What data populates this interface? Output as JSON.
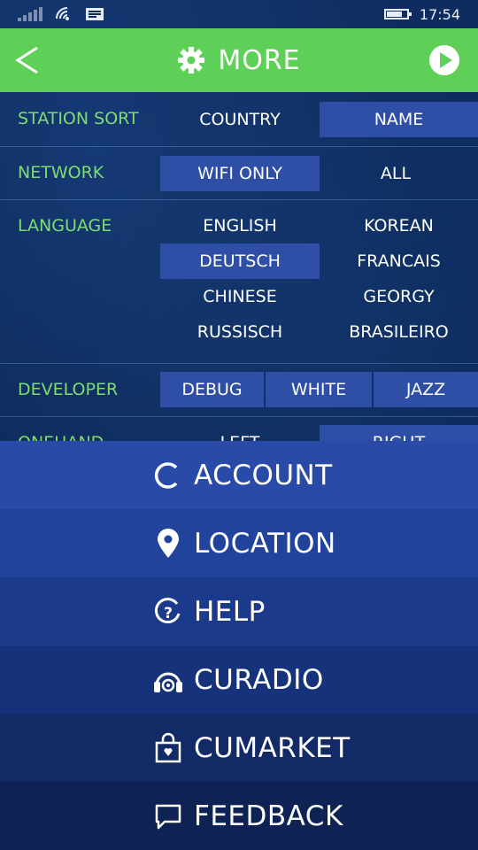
{
  "status": {
    "time": "17:54"
  },
  "header": {
    "title": "MORE"
  },
  "settings": {
    "station_sort": {
      "label": "STATION SORT",
      "options": [
        "COUNTRY",
        "NAME"
      ],
      "selected": "NAME"
    },
    "network": {
      "label": "NETWORK",
      "options": [
        "WIFI ONLY",
        "ALL"
      ],
      "selected": "WIFI ONLY"
    },
    "language": {
      "label": "LANGUAGE",
      "options": [
        "ENGLISH",
        "KOREAN",
        "DEUTSCH",
        "FRANCAIS",
        "CHINESE",
        "GEORGY",
        "RUSSISCH",
        "BRASILEIRO"
      ],
      "selected": "DEUTSCH"
    },
    "developer": {
      "label": "DEVELOPER",
      "options": [
        "DEBUG",
        "WHITE",
        "JAZZ"
      ]
    },
    "onehand": {
      "label": "ONEHAND",
      "options": [
        "LEFT",
        "RIGHT"
      ],
      "selected": "RIGHT"
    }
  },
  "menu": [
    {
      "label": "ACCOUNT",
      "icon": "account-icon"
    },
    {
      "label": "LOCATION",
      "icon": "location-pin-icon"
    },
    {
      "label": "HELP",
      "icon": "help-icon"
    },
    {
      "label": "CURADIO",
      "icon": "headphones-icon"
    },
    {
      "label": "CUMARKET",
      "icon": "shopping-bag-icon"
    },
    {
      "label": "FEEDBACK",
      "icon": "chat-bubble-icon"
    }
  ],
  "colors": {
    "accent_green": "#5ecf57",
    "selected_blue": "#2f4fa6",
    "label_green": "#7fdc72"
  }
}
